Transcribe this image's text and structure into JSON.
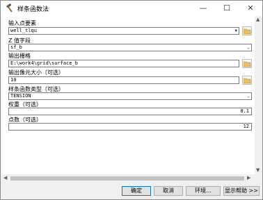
{
  "window": {
    "title": "样条函数法",
    "minimize_glyph": "—",
    "maximize_glyph": "☐",
    "close_glyph": "✕"
  },
  "form": {
    "input_points_label": "输入点要素",
    "input_points_value": "well_tlqu",
    "z_field_label": "Z 值字段",
    "z_field_value": "sf_b",
    "output_raster_label": "输出栅格",
    "output_raster_value": "E:\\work4\\grid\\surface_b",
    "cell_size_label": "输出像元大小（可选）",
    "cell_size_value": "10",
    "spline_type_label": "样条函数类型（可选）",
    "spline_type_value": "TENSION",
    "weight_label": "权重（可选）",
    "weight_value": "0.1",
    "points_label": "点数（可选）",
    "points_value": "12"
  },
  "buttons": {
    "ok": "确定",
    "cancel": "取消",
    "environments": "环境...",
    "show_help": "显示帮助 >>"
  },
  "icons": {
    "title": "hammer-icon",
    "folder": "folder-open-icon",
    "dropdown": "chevron-down-icon"
  },
  "colors": {
    "primary_border": "#0078d7",
    "folder_yellow": "#e8c15a"
  }
}
